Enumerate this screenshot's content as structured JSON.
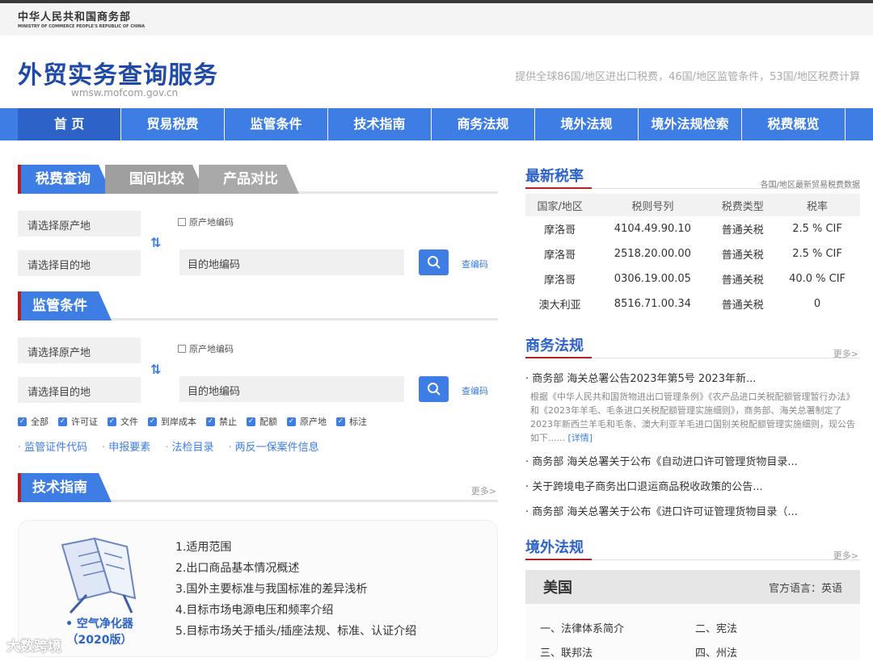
{
  "ministry": {
    "cn": "中华人民共和国商务部",
    "en": "MINISTRY OF COMMERCE PEOPLE'S REPUBLIC OF CHINA"
  },
  "header": {
    "title": "外贸实务查询服务",
    "url": "wmsw.mofcom.gov.cn",
    "slogan": "提供全球86国/地区进出口税费，46国/地区监管条件，53国/地区税费计算"
  },
  "nav": [
    "首 页",
    "贸易税费",
    "监管条件",
    "技术指南",
    "商务法规",
    "境外法规",
    "境外法规检索",
    "税费概览"
  ],
  "tax_query": {
    "tabs": [
      "税费查询",
      "国间比较",
      "产品对比"
    ],
    "origin_placeholder": "请选择原产地",
    "dest_placeholder": "请选择目的地",
    "origin_code_label": "原产地编码",
    "dest_code_placeholder": "目的地编码",
    "code_link": "查编码"
  },
  "supervision": {
    "title": "监管条件",
    "origin_placeholder": "请选择原产地",
    "dest_placeholder": "请选择目的地",
    "origin_code_label": "原产地编码",
    "dest_code_placeholder": "目的地编码",
    "code_link": "查编码",
    "filters": [
      "全部",
      "许可证",
      "文件",
      "到岸成本",
      "禁止",
      "配额",
      "原产地",
      "标注"
    ],
    "links": [
      "监管证件代码",
      "申报要素",
      "法检目录",
      "两反一保案件信息"
    ]
  },
  "tech_guide": {
    "title": "技术指南",
    "more": "更多>",
    "product_name": "• 空气净化器",
    "product_year": "（2020版）",
    "items": [
      "1.适用范围",
      "2.出口商品基本情况概述",
      "3.国外主要标准与我国标准的差异浅析",
      "4.目标市场电源电压和频率介绍",
      "5.目标市场关于插头/插座法规、标准、认证介绍"
    ]
  },
  "latest_rates": {
    "title": "最新税率",
    "subtitle": "各国/地区最新贸易税费数据",
    "columns": [
      "国家/地区",
      "税则号列",
      "税费类型",
      "税率"
    ],
    "rows": [
      [
        "摩洛哥",
        "4104.49.90.10",
        "普通关税",
        "2.5 % CIF"
      ],
      [
        "摩洛哥",
        "2518.20.00.00",
        "普通关税",
        "2.5 % CIF"
      ],
      [
        "摩洛哥",
        "0306.19.00.05",
        "普通关税",
        "40.0 % CIF"
      ],
      [
        "澳大利亚",
        "8516.71.00.34",
        "普通关税",
        "0"
      ]
    ]
  },
  "commerce_law": {
    "title": "商务法规",
    "more": "更多>",
    "items": [
      "· 商务部 海关总署公告2023年第5号 2023年新...",
      "· 商务部 海关总署关于公布《自动进口许可管理货物目录...",
      "· 关于跨境电子商务出口退运商品税收政策的公告...",
      "· 商务部 海关总署关于公布《进口许可证管理货物目录（..."
    ],
    "summary": "根据《中华人民共和国货物进出口管理条例》《农产品进口关税配额管理暂行办法》和《2023年羊毛、毛条进口关税配额管理实施细则》，商务部、海关总署制定了2023年新西兰羊毛和毛条、澳大利亚羊毛进口国别关税配额管理实施细则，现公告如下......",
    "detail": "[详情]"
  },
  "foreign_law": {
    "title": "境外法规",
    "more": "更多>",
    "country": "美国",
    "language": "官方语言：英语",
    "links": [
      "一、法律体系简介",
      "二、宪法",
      "三、联邦法",
      "四、州法"
    ]
  },
  "watermark": "大数跨境"
}
